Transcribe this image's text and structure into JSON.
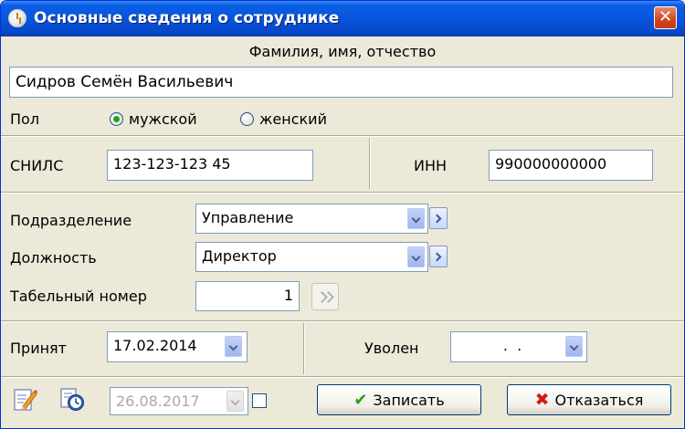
{
  "window": {
    "title": "Основные сведения о сотруднике",
    "close_glyph": "✕"
  },
  "fio": {
    "heading": "Фамилия, имя, отчество",
    "value": "Сидров Семён Васильевич"
  },
  "gender": {
    "label": "Пол",
    "options": [
      "мужской",
      "женский"
    ],
    "selected": "мужской"
  },
  "ids": {
    "snils_label": "СНИЛС",
    "snils_value": "123-123-123 45",
    "inn_label": "ИНН",
    "inn_value": "990000000000"
  },
  "position": {
    "department_label": "Подразделение",
    "department_value": "Управление",
    "job_label": "Должность",
    "job_value": "Директор",
    "tabnum_label": "Табельный номер",
    "tabnum_value": "1"
  },
  "dates": {
    "hired_label": "Принят",
    "hired_value": "17.02.2014",
    "fired_label": "Уволен",
    "fired_value": "  .  ."
  },
  "footer": {
    "date_value": "26.08.2017",
    "save_label": "Записать",
    "cancel_label": "Отказаться",
    "icons": [
      "edit-document-icon",
      "history-clock-icon"
    ]
  }
}
